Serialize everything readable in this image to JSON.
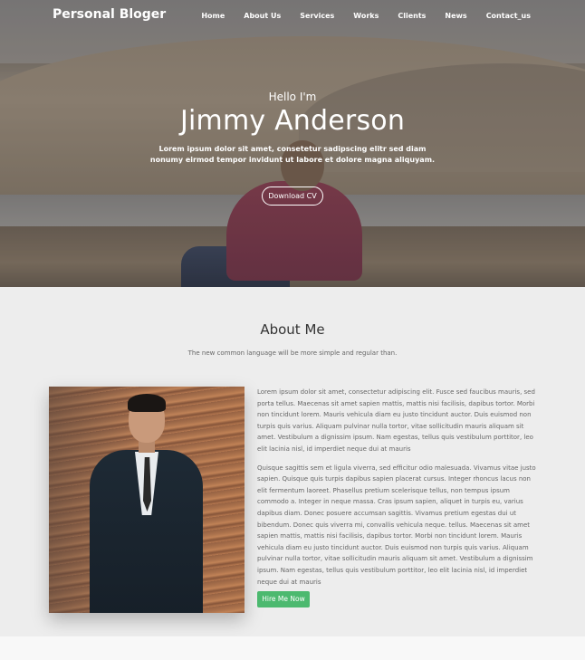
{
  "nav": {
    "brand": "Personal Bloger",
    "items": [
      "Home",
      "About Us",
      "Services",
      "Works",
      "Clients",
      "News",
      "Contact_us"
    ]
  },
  "hero": {
    "greeting": "Hello I'm",
    "name": "Jimmy Anderson",
    "description": "Lorem ipsum dolor sit amet, consetetur sadipscing elitr sed diam nonumy eirmod tempor invidunt ut labore et dolore magna aliquyam.",
    "cta_label": "Download CV"
  },
  "about": {
    "title": "About Me",
    "subtitle": "The new common language will be more simple and regular than.",
    "paragraph_1": "Lorem ipsum dolor sit amet, consectetur adipiscing elit. Fusce sed faucibus mauris, sed porta tellus. Maecenas sit amet sapien mattis, mattis nisi facilisis, dapibus tortor. Morbi non tincidunt lorem. Mauris vehicula diam eu justo tincidunt auctor. Duis euismod non turpis quis varius. Aliquam pulvinar nulla tortor, vitae sollicitudin mauris aliquam sit amet. Vestibulum a dignissim ipsum. Nam egestas, tellus quis vestibulum porttitor, leo elit lacinia nisl, id imperdiet neque dui at mauris",
    "paragraph_2": "Quisque sagittis sem et ligula viverra, sed efficitur odio malesuada. Vivamus vitae justo sapien. Quisque quis turpis dapibus sapien placerat cursus. Integer rhoncus lacus non elit fermentum laoreet. Phasellus pretium scelerisque tellus, non tempus ipsum commodo a. Integer in neque massa. Cras ipsum sapien, aliquet in turpis eu, varius dapibus diam. Donec posuere accumsan sagittis. Vivamus pretium egestas dui ut bibendum. Donec quis viverra mi, convallis vehicula neque. tellus. Maecenas sit amet sapien mattis, mattis nisi facilisis, dapibus tortor. Morbi non tincidunt lorem. Mauris vehicula diam eu justo tincidunt auctor. Duis euismod non turpis quis varius. Aliquam pulvinar nulla tortor, vitae sollicitudin mauris aliquam sit amet. Vestibulum a dignissim ipsum. Nam egestas, tellus quis vestibulum porttitor, leo elit lacinia nisl, id imperdiet neque dui at mauris",
    "cta_label": "Hire Me Now"
  },
  "colors": {
    "accent_green": "#4cb96f",
    "section_bg": "#ededed",
    "hero_text": "#ffffff"
  }
}
